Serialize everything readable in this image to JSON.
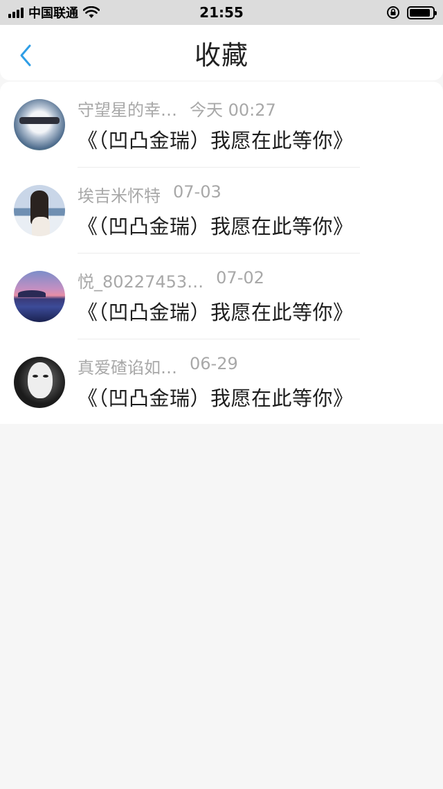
{
  "status_bar": {
    "carrier": "中国联通",
    "time": "21:55"
  },
  "nav": {
    "title": "收藏"
  },
  "favorites": [
    {
      "author": "守望星的幸…",
      "time": "今天 00:27",
      "title": "《（凹凸金瑞）我愿在此等你》"
    },
    {
      "author": "埃吉米怀特",
      "time": "07-03",
      "title": "《（凹凸金瑞）我愿在此等你》"
    },
    {
      "author": "悦_80227453…",
      "time": "07-02",
      "title": "《（凹凸金瑞）我愿在此等你》"
    },
    {
      "author": "真爱碴谄如…",
      "time": "06-29",
      "title": "《（凹凸金瑞）我愿在此等你》"
    }
  ],
  "colors": {
    "accent": "#2f9ee6",
    "meta_text": "#a8a8a8",
    "title_text": "#1d1d1d",
    "background": "#f6f6f6"
  },
  "icons": {
    "back": "chevron-left-icon",
    "signal": "signal-bars-icon",
    "wifi": "wifi-icon",
    "rotation_lock": "rotation-lock-icon",
    "battery": "battery-icon"
  }
}
